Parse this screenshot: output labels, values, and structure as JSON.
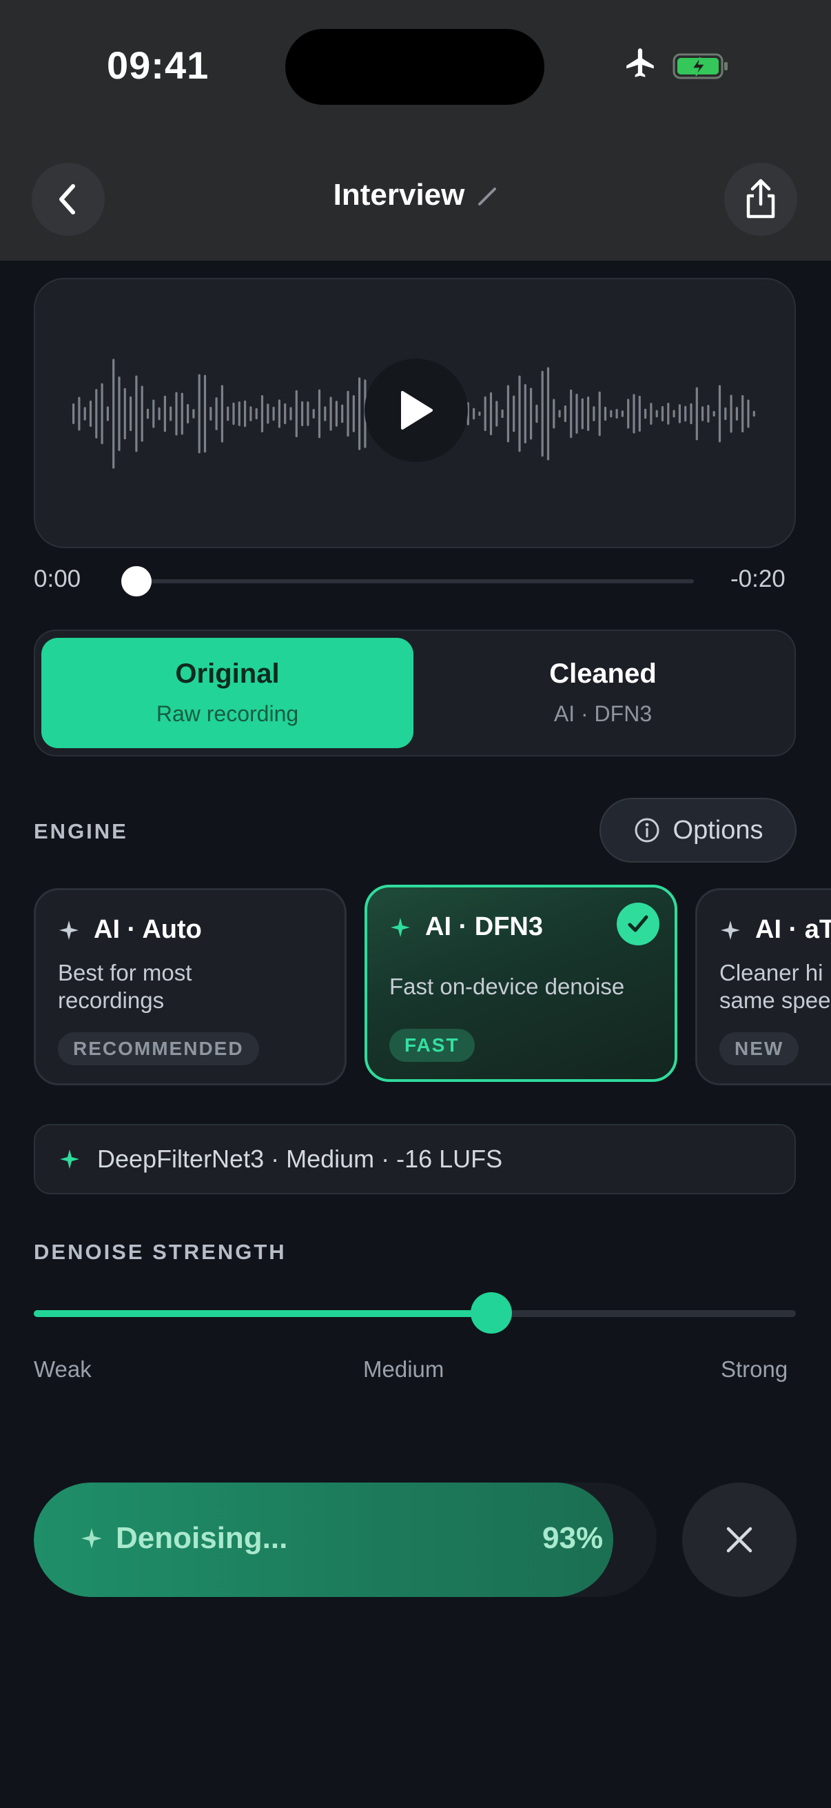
{
  "status_bar": {
    "time": "09:41"
  },
  "nav": {
    "title": "Interview",
    "back_icon": "chevron-left-icon",
    "share_icon": "share-icon",
    "edit_icon": "pencil-icon"
  },
  "player": {
    "elapsed": "0:00",
    "remaining": "-0:20",
    "progress_fraction": 0.0
  },
  "segmented": {
    "options": [
      {
        "title": "Original",
        "subtitle": "Raw recording",
        "selected": true
      },
      {
        "title": "Cleaned",
        "subtitle": "AI · DFN3",
        "selected": false
      }
    ]
  },
  "engine": {
    "label": "ENGINE",
    "options_label": "Options",
    "cards": [
      {
        "title": "AI · Auto",
        "description": "Best for most\nrecordings",
        "badge": "RECOMMENDED",
        "selected": false
      },
      {
        "title": "AI · DFN3",
        "description": "Fast on-device denoise",
        "badge": "FAST",
        "selected": true
      },
      {
        "title": "AI · aT",
        "description": "Cleaner hi\nsame spee",
        "badge": "NEW",
        "selected": false
      }
    ],
    "info": "DeepFilterNet3 · Medium · -16 LUFS"
  },
  "denoise": {
    "label": "DENOISE STRENGTH",
    "level_fraction": 0.6,
    "ticks": [
      "Weak",
      "Medium",
      "Strong"
    ]
  },
  "progress": {
    "label": "Denoising...",
    "percent_text": "93%",
    "fraction": 0.93
  },
  "colors": {
    "accent": "#22d497",
    "background": "#10131a",
    "header": "#2a2b2d"
  }
}
